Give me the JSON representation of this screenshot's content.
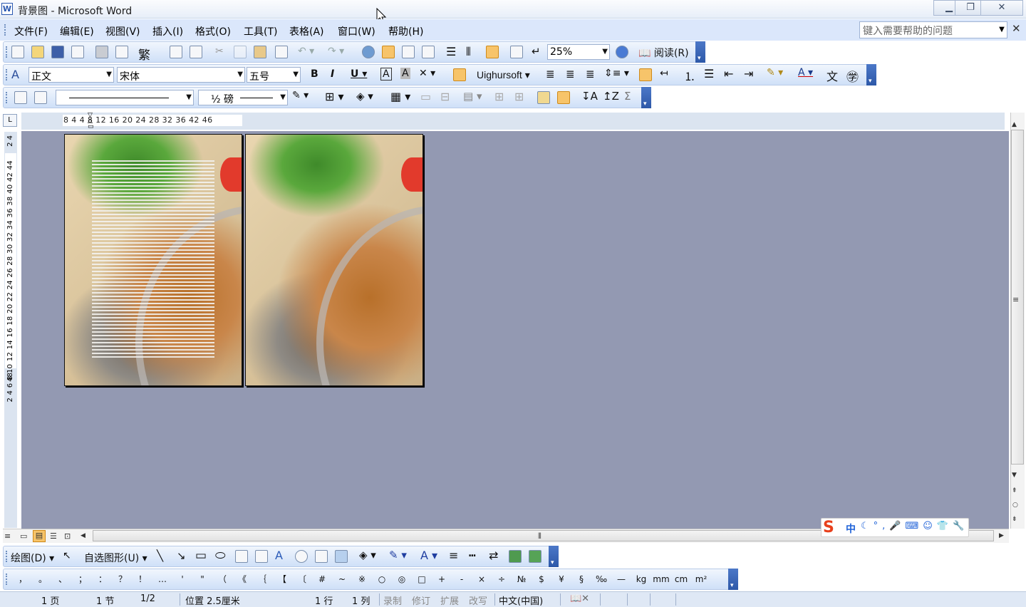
{
  "window": {
    "title": "背景图 - Microsoft Word",
    "app_icon": "W",
    "controls": [
      "minimize-icon",
      "restore-icon",
      "close-icon"
    ]
  },
  "menu": {
    "items": [
      "文件(F)",
      "编辑(E)",
      "视图(V)",
      "插入(I)",
      "格式(O)",
      "工具(T)",
      "表格(A)",
      "窗口(W)",
      "帮助(H)"
    ],
    "help_placeholder": "键入需要帮助的问题"
  },
  "standard_toolbar": {
    "zoom": "25%",
    "read_label": "阅读(R)"
  },
  "formatting_toolbar": {
    "style": "正文",
    "font": "宋体",
    "size": "五号",
    "script_font": "Uighursoft"
  },
  "tables_toolbar": {
    "line_weight": "½ 磅"
  },
  "ruler": {
    "horizontal": "8  4      4   8  12  16  20  24  28  32  36    42  46",
    "vertical_top": "2  4",
    "vertical_main": "2  4  6  8 10 12 14 16 18 20 22 24 26 28 30 32 34 36 38 40 42 44",
    "vertical_bottom": "48",
    "tab_selector": "L"
  },
  "drawing_toolbar": {
    "draw_label": "绘图(D)",
    "autoshape_label": "自选图形(U)"
  },
  "symbols_toolbar": {
    "symbols": [
      "，",
      "。",
      "、",
      "；",
      "：",
      "？",
      "！",
      "…",
      "'",
      "\"",
      "（",
      "《",
      "｛",
      "【",
      "〔",
      "#",
      "~",
      "※",
      "○",
      "◎",
      "□",
      "+",
      "-",
      "×",
      "÷",
      "№",
      "$",
      "¥",
      "§",
      "‰",
      "—",
      "kg",
      "mm",
      "cm",
      "m²"
    ]
  },
  "ime": {
    "mode": "中"
  },
  "status": {
    "page": "1 页",
    "section": "1 节",
    "page_of": "1/2",
    "position": "位置 2.5厘米",
    "line": "1 行",
    "column": "1 列",
    "rec": "录制",
    "trk": "修订",
    "ext": "扩展",
    "ovr": "改写",
    "language": "中文(中国)"
  }
}
